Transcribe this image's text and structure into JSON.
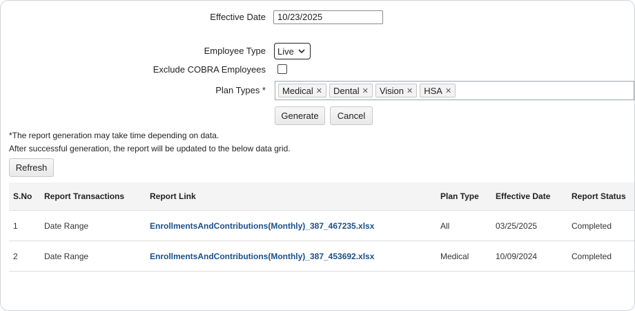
{
  "form": {
    "effective_date_label": "Effective Date",
    "effective_date_value": "10/23/2025",
    "employee_type_label": "Employee Type",
    "employee_type_value": "Live",
    "exclude_cobra_label": "Exclude COBRA Employees",
    "exclude_cobra_checked": false,
    "plan_types_label": "Plan Types *",
    "plan_types": [
      "Medical",
      "Dental",
      "Vision",
      "HSA"
    ],
    "remove_tag_glyph": "✕",
    "generate_label": "Generate",
    "cancel_label": "Cancel"
  },
  "notes": {
    "line1": "*The report generation may take time depending on data.",
    "line2": "After successful generation, the report will be updated to the below data grid."
  },
  "refresh_label": "Refresh",
  "grid": {
    "columns": [
      "S.No",
      "Report Transactions",
      "Report Link",
      "Plan Type",
      "Effective Date",
      "Report Status"
    ],
    "rows": [
      {
        "sno": "1",
        "transactions": "Date Range",
        "link": "EnrollmentsAndContributions(Monthly)_387_467235.xlsx",
        "plan_type": "All",
        "effective_date": "03/25/2025",
        "status": "Completed"
      },
      {
        "sno": "2",
        "transactions": "Date Range",
        "link": "EnrollmentsAndContributions(Monthly)_387_453692.xlsx",
        "plan_type": "Medical",
        "effective_date": "10/09/2024",
        "status": "Completed"
      }
    ]
  }
}
